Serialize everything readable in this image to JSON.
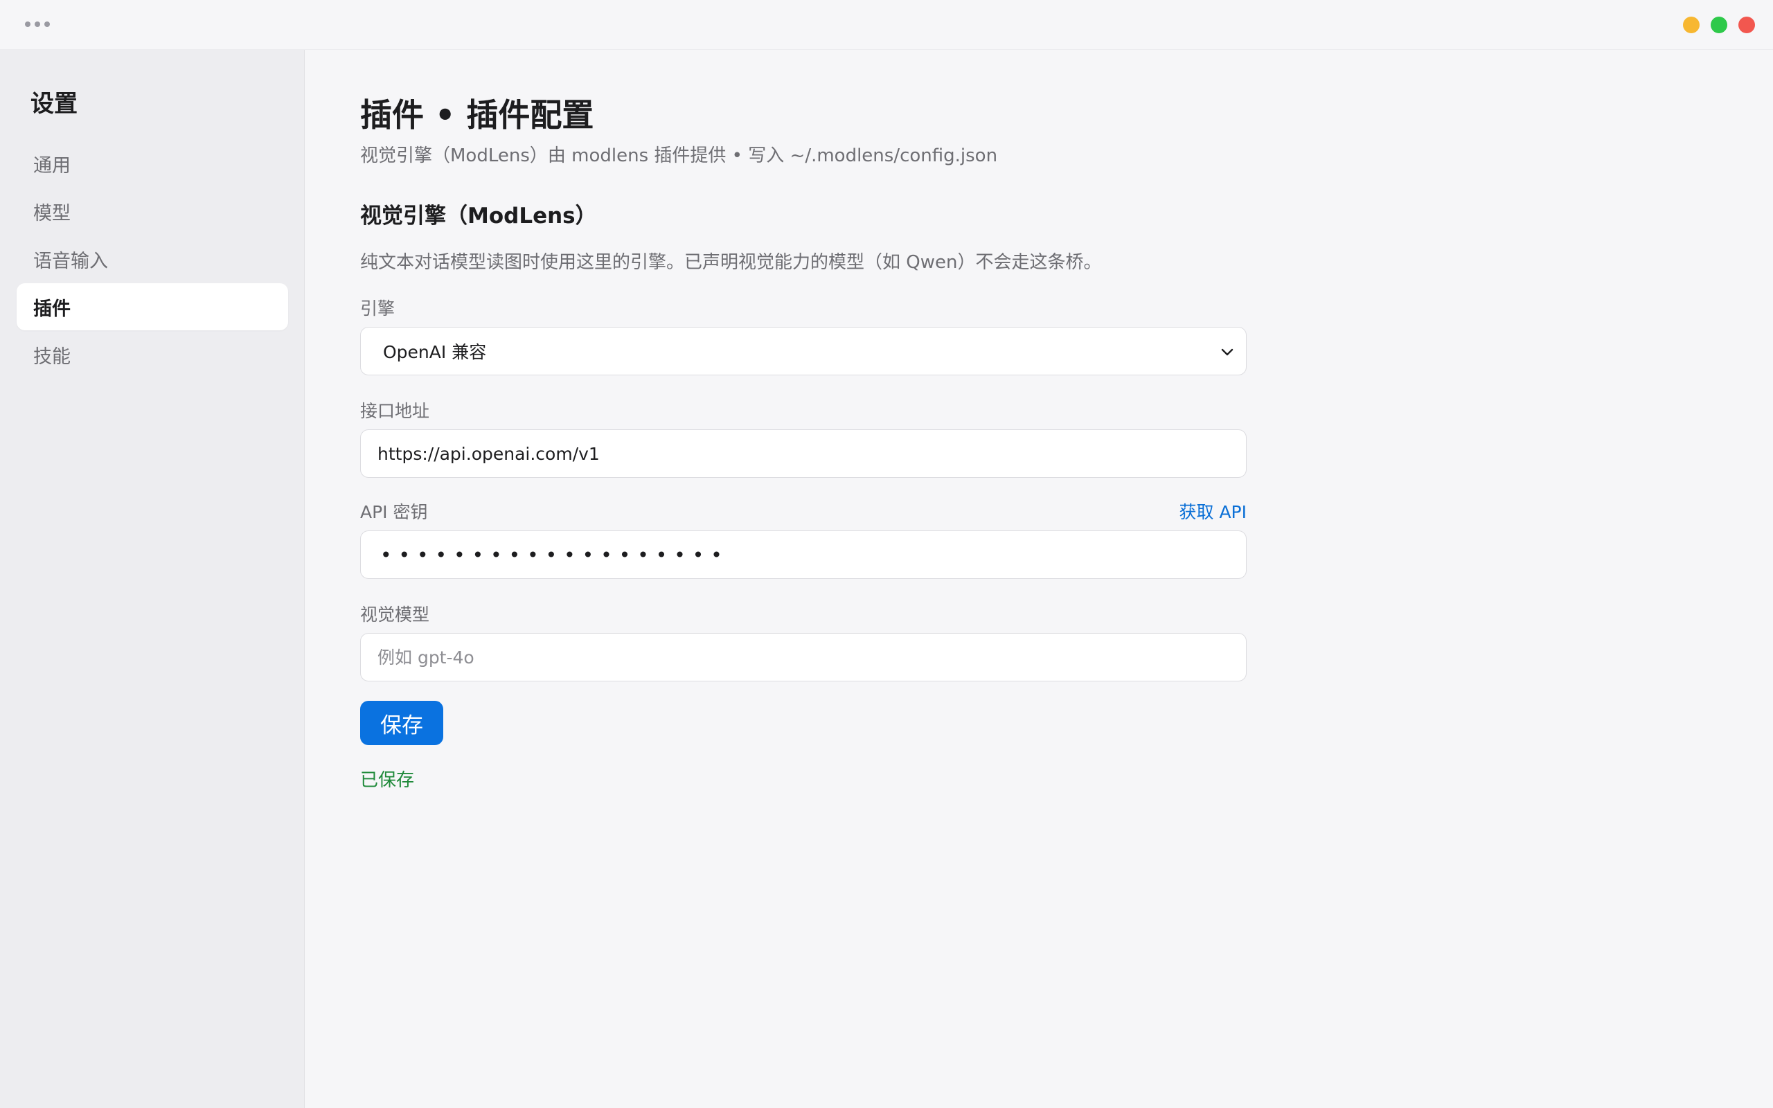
{
  "window": {
    "colors": {
      "minimize": "#f7b731",
      "maximize": "#2ec94a",
      "close": "#f2574f"
    }
  },
  "sidebar": {
    "title": "设置",
    "items": [
      {
        "label": "通用",
        "active": false
      },
      {
        "label": "模型",
        "active": false
      },
      {
        "label": "语音输入",
        "active": false
      },
      {
        "label": "插件",
        "active": true
      },
      {
        "label": "技能",
        "active": false
      }
    ]
  },
  "main": {
    "title": "插件 • 插件配置",
    "subtitle": "视觉引擎（ModLens）由 modlens 插件提供 • 写入 ~/.modlens/config.json",
    "section_title": "视觉引擎（ModLens）",
    "section_desc": "纯文本对话模型读图时使用这里的引擎。已声明视觉能力的模型（如 Qwen）不会走这条桥。",
    "engine": {
      "label": "引擎",
      "value": "OpenAI 兼容"
    },
    "endpoint": {
      "label": "接口地址",
      "value": "https://api.openai.com/v1"
    },
    "api_key": {
      "label": "API 密钥",
      "link": "获取 API",
      "masked_value": "•••••••••••••••••••"
    },
    "vision_model": {
      "label": "视觉模型",
      "value": "",
      "placeholder": "例如 gpt-4o"
    },
    "save_label": "保存",
    "save_status": "已保存",
    "colors": {
      "accent": "#0a72e0",
      "link": "#0a6fd6",
      "success": "#1f8a3a"
    }
  }
}
